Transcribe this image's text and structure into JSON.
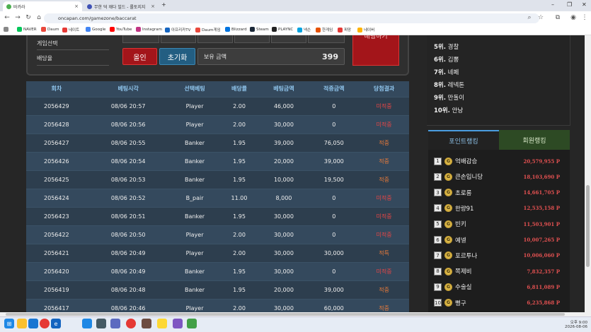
{
  "browser": {
    "tabs": [
      {
        "title": "바카라",
        "icon_color": "#4caf50"
      },
      {
        "title": "무한 덕 깨다 빌드 - 롤토지지",
        "icon_color": "#3f51b5"
      }
    ],
    "new_tab": "+",
    "url": "oncapan.com/gamezone/baccarat",
    "bookmarks": [
      {
        "label": "NAVER",
        "color": "#03c75a"
      },
      {
        "label": "Daum",
        "color": "#e9483c"
      },
      {
        "label": "네이트",
        "color": "#e53935"
      },
      {
        "label": "Google",
        "color": "#4285f4"
      },
      {
        "label": "YouTube",
        "color": "#ff0000"
      },
      {
        "label": "Instagram",
        "color": "#c13584"
      },
      {
        "label": "아프리카TV",
        "color": "#1565c0"
      },
      {
        "label": "Daum게임",
        "color": "#e9483c"
      },
      {
        "label": "Blizzard",
        "color": "#0074e0"
      },
      {
        "label": "Steam",
        "color": "#1b2838"
      },
      {
        "label": "PLAYNC",
        "color": "#222222"
      },
      {
        "label": "넥슨",
        "color": "#00a3e0"
      },
      {
        "label": "한게임",
        "color": "#e65100"
      },
      {
        "label": "피망",
        "color": "#e53935"
      },
      {
        "label": "네이버",
        "color": "#ffb300"
      }
    ]
  },
  "game_panel": {
    "menu": [
      "게임선택",
      "배당율"
    ],
    "all_in": "올인",
    "reset": "초기화",
    "balance_label": "보유 금액",
    "balance_value": "399",
    "bet_button": "배팅하기"
  },
  "history_table": {
    "headers": [
      "회차",
      "베팅시각",
      "선택베팅",
      "배당률",
      "베팅금액",
      "적중금액",
      "당첨결과"
    ],
    "rows": [
      [
        "2056429",
        "08/06 20:57",
        "Player",
        "2.00",
        "46,000",
        "0",
        "미적중"
      ],
      [
        "2056428",
        "08/06 20:56",
        "Player",
        "2.00",
        "30,000",
        "0",
        "미적중"
      ],
      [
        "2056427",
        "08/06 20:55",
        "Banker",
        "1.95",
        "39,000",
        "76,050",
        "적중"
      ],
      [
        "2056426",
        "08/06 20:54",
        "Banker",
        "1.95",
        "20,000",
        "39,000",
        "적중"
      ],
      [
        "2056425",
        "08/06 20:53",
        "Banker",
        "1.95",
        "10,000",
        "19,500",
        "적중"
      ],
      [
        "2056424",
        "08/06 20:52",
        "B_pair",
        "11.00",
        "8,000",
        "0",
        "미적중"
      ],
      [
        "2056423",
        "08/06 20:51",
        "Banker",
        "1.95",
        "30,000",
        "0",
        "미적중"
      ],
      [
        "2056422",
        "08/06 20:50",
        "Player",
        "2.00",
        "30,000",
        "0",
        "미적중"
      ],
      [
        "2056421",
        "08/06 20:49",
        "Player",
        "2.00",
        "30,000",
        "30,000",
        "적특"
      ],
      [
        "2056420",
        "08/06 20:49",
        "Banker",
        "1.95",
        "30,000",
        "0",
        "미적중"
      ],
      [
        "2056419",
        "08/06 20:48",
        "Banker",
        "1.95",
        "20,000",
        "39,000",
        "적중"
      ],
      [
        "2056417",
        "08/06 20:46",
        "Player",
        "2.00",
        "30,000",
        "60,000",
        "적중"
      ]
    ]
  },
  "top_ranks": [
    {
      "rank": "5위.",
      "name": "경찰"
    },
    {
      "rank": "6위.",
      "name": "김뽕"
    },
    {
      "rank": "7위.",
      "name": "네페"
    },
    {
      "rank": "8위.",
      "name": "레넥톤"
    },
    {
      "rank": "9위.",
      "name": "만돌이"
    },
    {
      "rank": "10위.",
      "name": "안낭"
    }
  ],
  "ranking_tabs": {
    "point": "포인트랭킹",
    "member": "회원랭킹"
  },
  "point_ranking": [
    {
      "num": "1",
      "name": "억배감승",
      "points": "20,579,955 P"
    },
    {
      "num": "2",
      "name": "큰손입니당",
      "points": "18,103,690 P"
    },
    {
      "num": "3",
      "name": "초로롱",
      "points": "14,661,705 P"
    },
    {
      "num": "4",
      "name": "한량91",
      "points": "12,535,158 P"
    },
    {
      "num": "5",
      "name": "빈키",
      "points": "11,503,901 P"
    },
    {
      "num": "6",
      "name": "예넬",
      "points": "10,007,265 P"
    },
    {
      "num": "7",
      "name": "포르투나",
      "points": "10,006,060 P"
    },
    {
      "num": "8",
      "name": "쪽제비",
      "points": "7,832,357 P"
    },
    {
      "num": "9",
      "name": "수술실",
      "points": "6,811,089 P"
    },
    {
      "num": "10",
      "name": "뻥구",
      "points": "6,235,868 P"
    }
  ],
  "taskbar": {
    "time": "오후 9:00",
    "date": "2026-08-06"
  }
}
